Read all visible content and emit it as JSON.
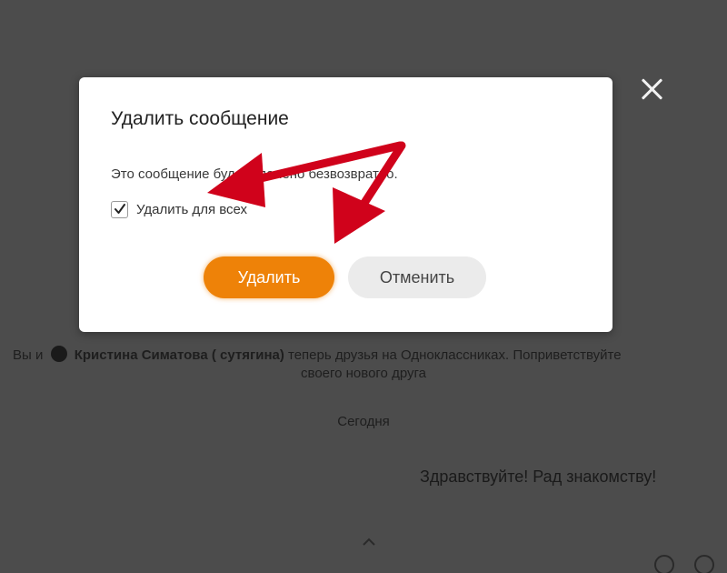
{
  "background": {
    "system_message_prefix": "Вы и",
    "friend_name": "Кристина Симатова ( сутягина)",
    "system_message_suffix": "теперь друзья на Одноклассниках. Поприветствуйте",
    "system_message_line2": "своего нового друга",
    "day_separator": "Сегодня",
    "message_text": "Здравствуйте! Рад знакомству!"
  },
  "dialog": {
    "title": "Удалить сообщение",
    "text": "Это сообщение будет удалено безвозвратно.",
    "checkbox_label": "Удалить для всех",
    "checkbox_checked": true,
    "delete_label": "Удалить",
    "cancel_label": "Отменить"
  },
  "colors": {
    "accent": "#ee8208",
    "arrow": "#d0021b",
    "overlay": "#4c4c4c"
  },
  "icons": [
    "close-icon",
    "checkmark-icon",
    "chevron-up-icon"
  ]
}
